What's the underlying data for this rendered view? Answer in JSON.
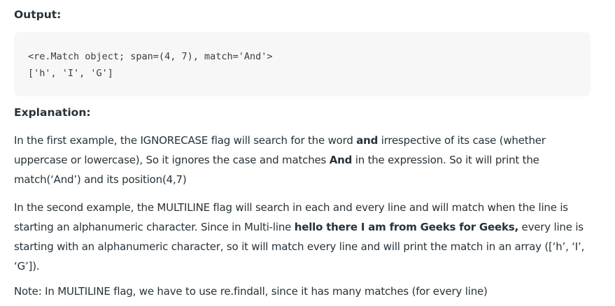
{
  "output_heading": "Output:",
  "code_lines": [
    "<re.Match object; span=(4, 7), match='And'>",
    "['h', 'I', 'G']"
  ],
  "explanation_heading": "Explanation:",
  "para1": {
    "a": "In the first example, the IGNORECASE flag will search for the word ",
    "b1": "and",
    "c": " irrespective of its case (whether uppercase or lowercase), So it ignores the case and matches ",
    "b2": "And",
    "d": " in the expression. So it will print the match(‘And’) and its position(4,7)"
  },
  "para2": {
    "a": "In the second example, the MULTILINE flag will search in each and every line and will match when the line is starting an alphanumeric character. Since in Multi-line ",
    "b": "hello there I am from Geeks for Geeks,",
    "c": " every line is starting with an alphanumeric character, so it will match every line and will print the match in an array ([‘h’, ‘I’, ‘G’])."
  },
  "note": "Note: In MULTILINE flag, we have to use re.findall, since it has many matches (for every line)"
}
